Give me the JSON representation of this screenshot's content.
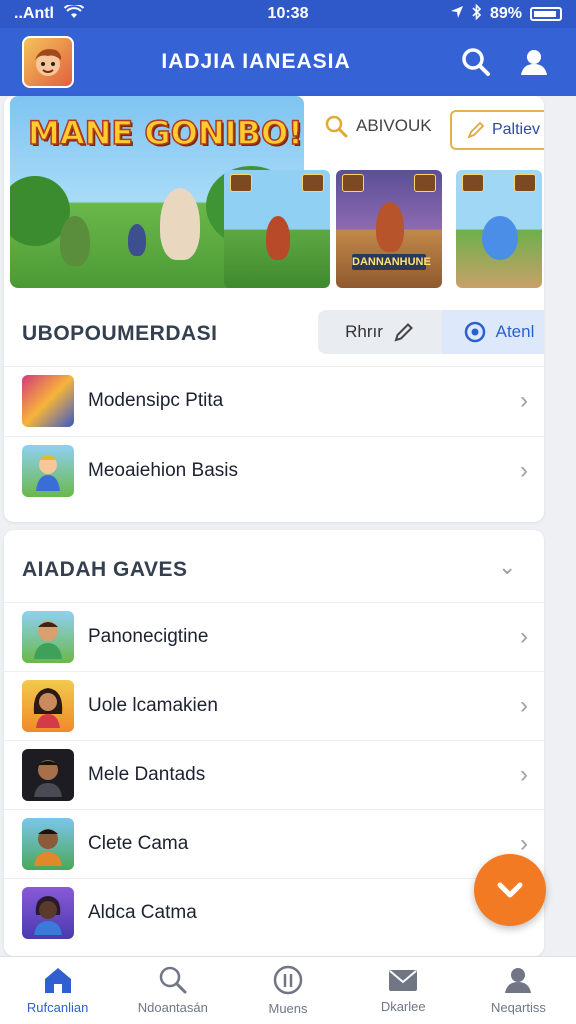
{
  "status": {
    "carrier": "..Antl",
    "time": "10:38",
    "battery": "89%"
  },
  "header": {
    "title": "IADJIA IANEASIA",
    "logo_icon": "game-character-face",
    "search_icon": "search-icon",
    "profile_icon": "user-icon"
  },
  "hero": {
    "logo_text": "MANE GONIBO!",
    "thumb_label": "DANNANHUNE"
  },
  "actions": {
    "search_label": "ABIVOUK",
    "publish_label": "Paltiev"
  },
  "section1": {
    "title": "UBOPOUMERDASI",
    "pill_a": "Rhrır",
    "pill_b": "Atenl",
    "items": [
      {
        "label": "Modensipc Ptita",
        "icon": "game-cover-icon"
      },
      {
        "label": "Meoaiehion Basis",
        "icon": "character-icon"
      }
    ]
  },
  "section2": {
    "title": "AIADAH GAVES",
    "items": [
      {
        "label": "Panonecigtine",
        "icon": "avatar-icon"
      },
      {
        "label": "Uole lcamakien",
        "icon": "avatar-icon"
      },
      {
        "label": "Mele Dantads",
        "icon": "avatar-icon"
      },
      {
        "label": "Clete Cama",
        "icon": "avatar-icon"
      },
      {
        "label": "Aldca Catma",
        "icon": "avatar-icon"
      }
    ]
  },
  "tabs": [
    {
      "label": "Rufcanlian",
      "icon": "home-icon",
      "active": true
    },
    {
      "label": "Ndoantasán",
      "icon": "search-icon",
      "active": false
    },
    {
      "label": "Muens",
      "icon": "info-icon",
      "active": false
    },
    {
      "label": "Dkarlee",
      "icon": "mail-icon",
      "active": false
    },
    {
      "label": "Neqartiss",
      "icon": "user-icon",
      "active": false
    }
  ],
  "colors": {
    "primary": "#3563d6",
    "accent": "#f27a22",
    "active_tab": "#2f5fd0"
  }
}
